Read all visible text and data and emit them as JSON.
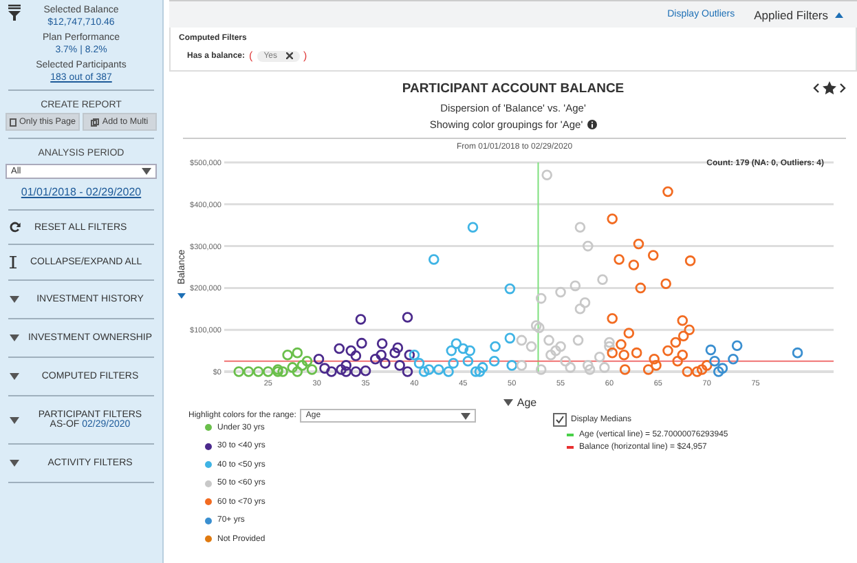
{
  "sidebar": {
    "summary": [
      {
        "label": "Selected Balance",
        "value": "$12,747,710.46"
      },
      {
        "label": "Plan Performance",
        "value": "3.7% | 8.2%"
      },
      {
        "label": "Selected Participants",
        "value": "183 out of  387"
      }
    ],
    "create_report": {
      "title": "CREATE REPORT",
      "buttons": [
        {
          "kind": "page",
          "label": "Only this Page"
        },
        {
          "kind": "multi",
          "label": "Add to Multi"
        }
      ]
    },
    "analysis_period": {
      "title": "ANALYSIS PERIOD",
      "select": "All",
      "range": "01/01/2018 - 02/29/2020"
    },
    "actions": [
      {
        "kind": "reset",
        "label": "RESET ALL FILTERS"
      },
      {
        "kind": "collapse",
        "label": "COLLAPSE/EXPAND ALL"
      }
    ],
    "sections": [
      {
        "label": "INVESTMENT HISTORY"
      },
      {
        "label": "INVESTMENT OWNERSHIP"
      },
      {
        "label": "COMPUTED FILTERS"
      },
      {
        "label": "PARTICIPANT FILTERS",
        "as_of": "AS-OF",
        "date": "02/29/2020"
      },
      {
        "label": "ACTIVITY FILTERS"
      }
    ]
  },
  "top_bar": {
    "display_outliers": "Display Outliers",
    "applied_filters": "Applied Filters"
  },
  "filters": {
    "group": "Computed Filters",
    "label": "Has a balance:",
    "open": "(",
    "close": ")",
    "chips": [
      "Yes"
    ]
  },
  "chart": {
    "title": "PARTICIPANT ACCOUNT BALANCE",
    "subtitle": "Dispersion of 'Balance' vs. 'Age'",
    "grouping": "Showing color groupings for 'Age'",
    "range": "From 01/01/2018 to 02/29/2020",
    "count": "Count: 179 (NA: 0, Outliers: 4)",
    "chart_data": {
      "type": "scatter",
      "grid": true,
      "xlabel": "Age",
      "ylabel": "Balance",
      "xlim": [
        20.5,
        83
      ],
      "ylim": [
        0,
        500000
      ],
      "xticks": [
        25,
        30,
        35,
        40,
        45,
        50,
        55,
        60,
        65,
        70,
        75
      ],
      "yticks": [
        {
          "value": 0,
          "label": "$0"
        },
        {
          "value": 100000,
          "label": "$100,000"
        },
        {
          "value": 200000,
          "label": "$200,000"
        },
        {
          "value": 300000,
          "label": "$300,000"
        },
        {
          "value": 400000,
          "label": "$400,000"
        },
        {
          "value": 500000,
          "label": "$500,000"
        }
      ],
      "series": [
        {
          "name": "Under 30 yrs",
          "color": "#6abf4b",
          "x": [
            22,
            23,
            24,
            25,
            26,
            26.5,
            27,
            28,
            27.5,
            28.5,
            29,
            29.5,
            26,
            28
          ],
          "values": [
            0,
            0,
            0,
            0,
            0,
            0,
            40000,
            45000,
            10000,
            15000,
            25000,
            5000,
            5000,
            0
          ]
        },
        {
          "name": "30 to <40 yrs",
          "color": "#4b2a8c",
          "x": [
            30.2,
            30.8,
            32.3,
            32.5,
            33,
            33.5,
            34,
            34,
            34.5,
            34.6,
            35,
            36,
            36.7,
            36.6,
            37,
            38,
            38.3,
            38.5,
            39.3,
            39.5,
            39.3,
            33,
            31.5
          ],
          "values": [
            30000,
            8000,
            55000,
            5000,
            15000,
            50000,
            38000,
            0,
            125000,
            68000,
            2000,
            30000,
            67000,
            40000,
            20000,
            45000,
            57000,
            15000,
            130000,
            40000,
            0,
            0,
            0
          ]
        },
        {
          "name": "40 to <50 yrs",
          "color": "#3fb4e5",
          "x": [
            40,
            40.5,
            41,
            41.5,
            42,
            42.5,
            43.5,
            44,
            43.8,
            44.3,
            45,
            45.7,
            46,
            45.5,
            46.3,
            46.7,
            47,
            48.2,
            48.3,
            49.8,
            49.8,
            50
          ],
          "values": [
            40000,
            20000,
            0,
            5000,
            268000,
            5000,
            0,
            20000,
            50000,
            67000,
            55000,
            50000,
            345000,
            25000,
            0,
            0,
            10000,
            25000,
            60000,
            198000,
            80000,
            15000
          ]
        },
        {
          "name": "50 to <60 yrs",
          "color": "#c8c8c8",
          "x": [
            51,
            51,
            52,
            52.5,
            52.8,
            53,
            53,
            53.6,
            53.8,
            54,
            54.5,
            55,
            55,
            55.5,
            56,
            56.5,
            56.8,
            57,
            57,
            57.5,
            57.8,
            58,
            57.8,
            59,
            59.3,
            59.5,
            60,
            60
          ],
          "values": [
            75000,
            15000,
            60000,
            110000,
            105000,
            175000,
            5000,
            470000,
            75000,
            40000,
            50000,
            190000,
            60000,
            25000,
            10000,
            205000,
            75000,
            345000,
            150000,
            165000,
            300000,
            5000,
            15000,
            35000,
            220000,
            10000,
            70000,
            60000
          ]
        },
        {
          "name": "60 to <70 yrs",
          "color": "#f26b21",
          "x": [
            60.3,
            60.3,
            60.3,
            61,
            61.2,
            61.5,
            61.6,
            62,
            62.5,
            62.8,
            63,
            63.2,
            64,
            64.5,
            64.6,
            64.8,
            65.8,
            66,
            66,
            66.8,
            67,
            67.5,
            67.5,
            67.6,
            68,
            68.2,
            68.3,
            69,
            69.5,
            70
          ],
          "values": [
            365000,
            127000,
            45000,
            268000,
            65000,
            40000,
            5000,
            92000,
            255000,
            45000,
            305000,
            200000,
            5000,
            278000,
            30000,
            15000,
            210000,
            430000,
            50000,
            70000,
            25000,
            122000,
            40000,
            85000,
            0,
            100000,
            265000,
            0,
            5000,
            15000
          ]
        },
        {
          "name": "70+ yrs",
          "color": "#3a8fd0",
          "x": [
            70.4,
            70.8,
            71.2,
            71.6,
            72.7,
            73.1,
            79.3
          ],
          "values": [
            52000,
            25000,
            0,
            8000,
            30000,
            62000,
            45000
          ]
        }
      ],
      "ref_lines": [
        {
          "axis": "x",
          "value": 52.700000762939,
          "color": "#7ee07e"
        },
        {
          "axis": "y",
          "value": 24957,
          "color": "#f07070"
        }
      ]
    }
  },
  "highlight": {
    "label": "Highlight colors for the range:",
    "select": "Age",
    "legend": [
      {
        "label": "Not Provided",
        "color": "#e07a10"
      }
    ]
  },
  "medians": {
    "label": "Display Medians",
    "checked": true,
    "lines": [
      {
        "label": "Age (vertical line) = 52.70000076293945",
        "color": "#49d049"
      },
      {
        "label": "Balance (horizontal line) = $24,957",
        "color": "#e83030"
      }
    ]
  }
}
